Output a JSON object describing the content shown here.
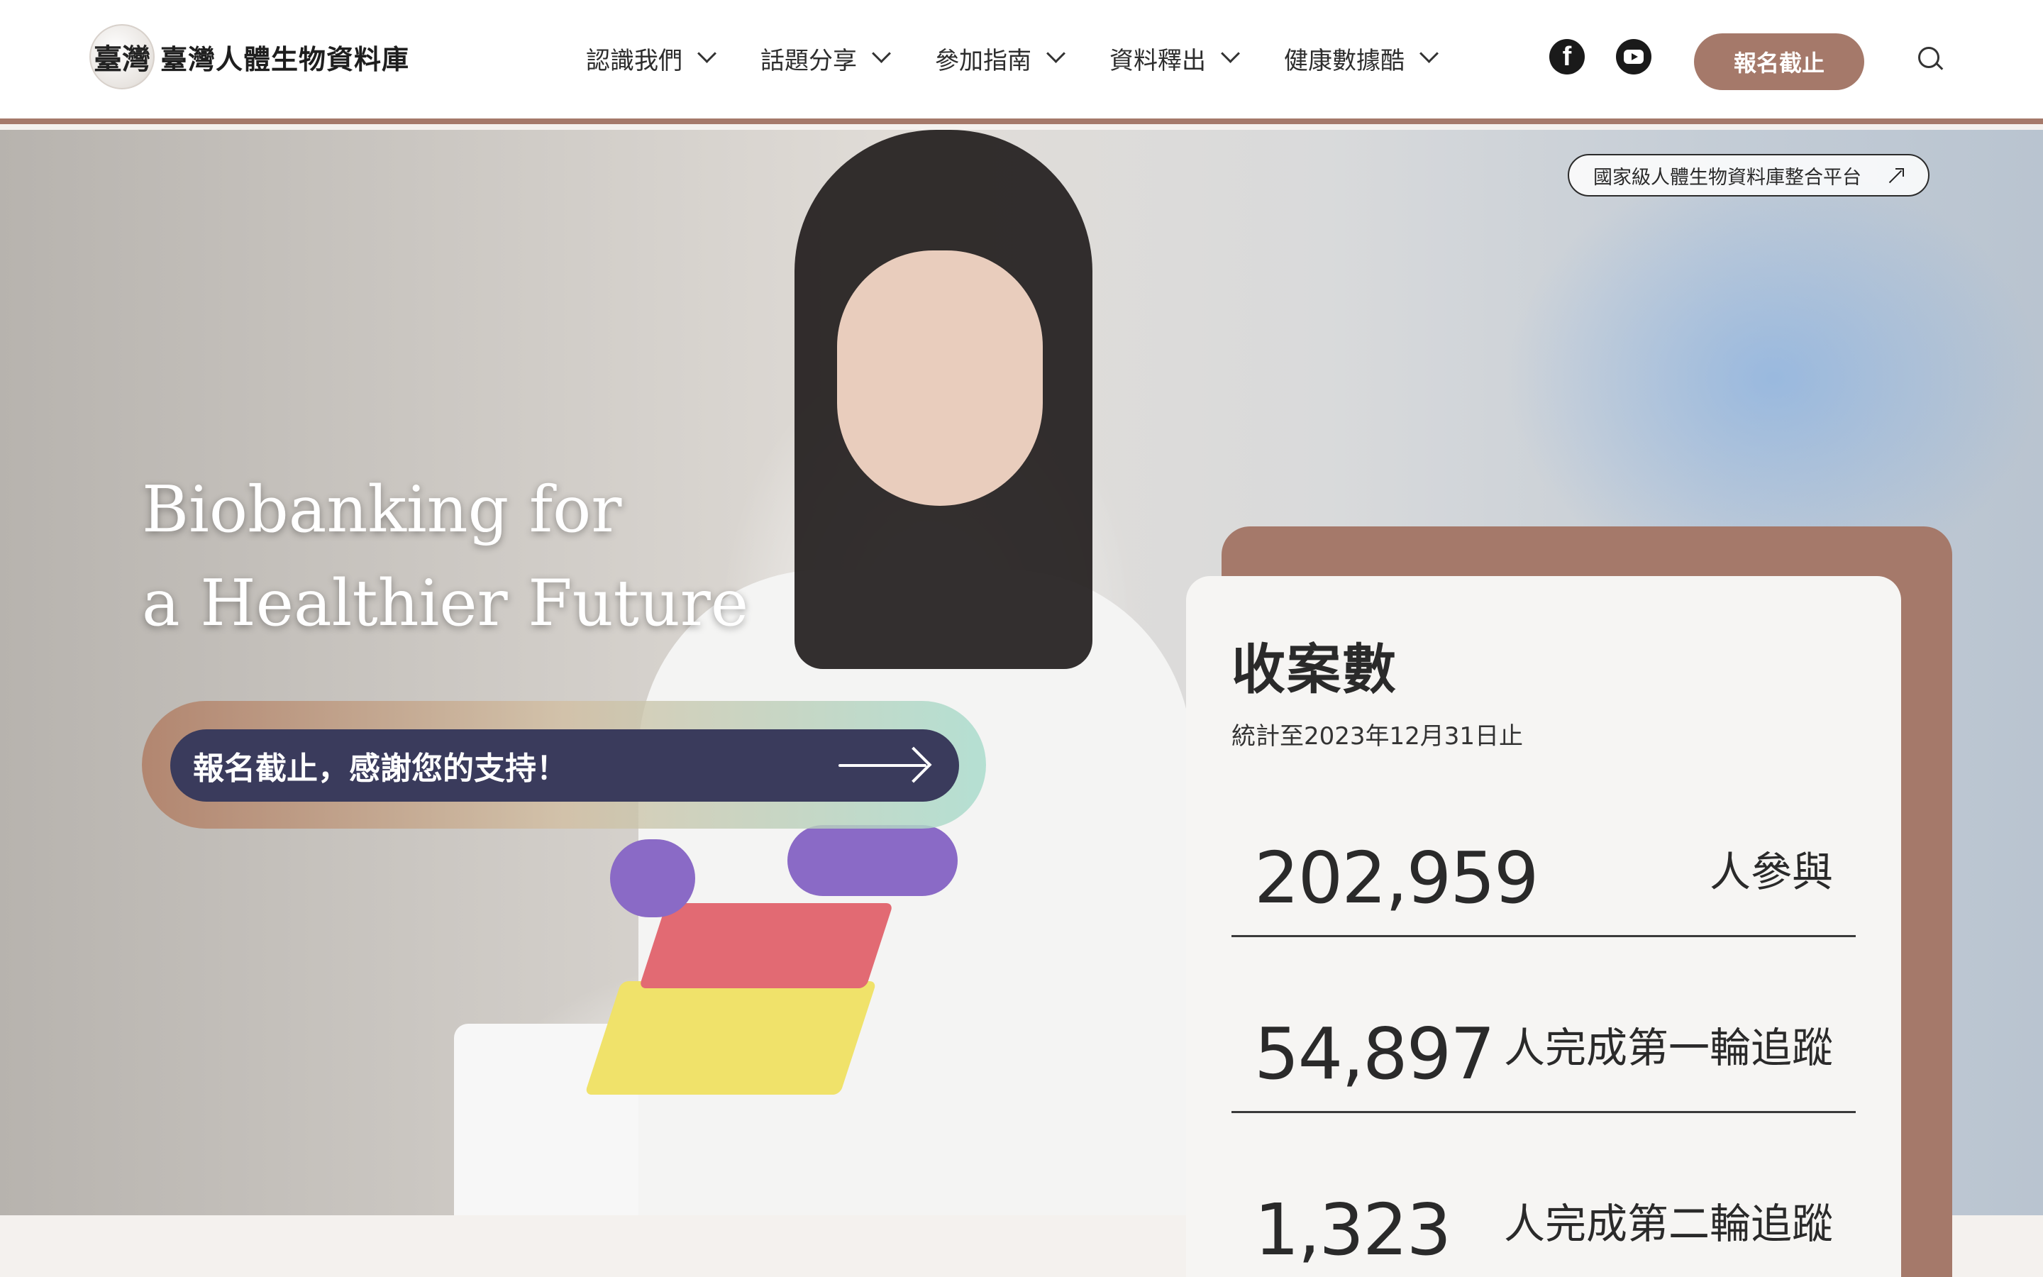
{
  "header": {
    "logo_seal": "臺灣",
    "logo_text": "臺灣人體生物資料庫",
    "nav": [
      {
        "label": "認識我們"
      },
      {
        "label": "話題分享"
      },
      {
        "label": "參加指南"
      },
      {
        "label": "資料釋出"
      },
      {
        "label": "健康數據酷"
      }
    ],
    "social": {
      "facebook_icon": "facebook-icon",
      "youtube_icon": "youtube-icon"
    },
    "cta_label": "報名截止",
    "search_icon": "search-icon"
  },
  "hero": {
    "platform_link": "國家級人體生物資料庫整合平台",
    "title_line1": "Biobanking for",
    "title_line2": "a Healthier Future",
    "cta_label": "報名截止，感謝您的支持！"
  },
  "stats": {
    "title": "收案數",
    "subtitle": "統計至2023年12月31日止",
    "items": [
      {
        "value": "202,959",
        "label": "人參與"
      },
      {
        "value": "54,897",
        "label": "人完成第一輪追蹤"
      },
      {
        "value": "1,323",
        "label": "人完成第二輪追蹤"
      }
    ]
  },
  "colors": {
    "accent": "#a5796a",
    "cta_dark": "#3a3b5c",
    "card_bg": "#f6f5f3"
  }
}
